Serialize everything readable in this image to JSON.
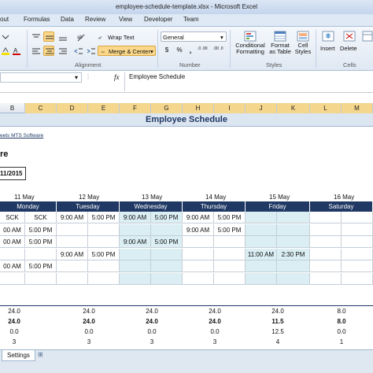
{
  "window": {
    "title": "employee-schedule-template.xlsx - Microsoft Excel"
  },
  "ribbon_tabs": [
    "out",
    "Formulas",
    "Data",
    "Review",
    "View",
    "Developer",
    "Team"
  ],
  "ribbon": {
    "wrap_text": "Wrap Text",
    "merge_center": "Merge & Center",
    "number_format": "General",
    "conditional_formatting": "Conditional Formatting",
    "format_as_table": "Format as Table",
    "cell_styles": "Cell Styles",
    "insert": "Insert",
    "delete": "Delete",
    "groups": {
      "alignment": "Alignment",
      "number": "Number",
      "styles": "Styles",
      "cells": "Cells"
    },
    "currency_symbol": "$",
    "percent_symbol": "%",
    "comma_symbol": ",",
    "inc_decimal": ".0 .00",
    "dec_decimal": ".00 .0"
  },
  "formula_bar": {
    "fx": "fx",
    "content": "Employee Schedule"
  },
  "columns": [
    "B",
    "C",
    "D",
    "E",
    "F",
    "G",
    "H",
    "I",
    "J",
    "K",
    "L",
    "M"
  ],
  "sheet": {
    "title": "Employee Schedule",
    "link_text": "eets MTS Software",
    "partial_label": "re",
    "date_box": "11/2015",
    "dates": [
      "11 May",
      "12 May",
      "13 May",
      "14 May",
      "15 May",
      "16 May"
    ],
    "days": [
      "Monday",
      "Tuesday",
      "Wednesday",
      "Thursday",
      "Friday",
      "Saturday"
    ],
    "rows": [
      [
        "SCK",
        "SCK",
        "9:00 AM",
        "5:00 PM",
        "9:00 AM",
        "5:00 PM",
        "9:00 AM",
        "5:00 PM",
        "",
        "",
        "",
        ""
      ],
      [
        "00 AM",
        "5:00 PM",
        "",
        "",
        "",
        "",
        "9:00 AM",
        "5:00 PM",
        "",
        "",
        "",
        ""
      ],
      [
        "00 AM",
        "5:00 PM",
        "",
        "",
        "9:00 AM",
        "5:00 PM",
        "",
        "",
        "",
        "",
        "",
        ""
      ],
      [
        "",
        "",
        "9:00 AM",
        "5:00 PM",
        "",
        "",
        "",
        "",
        "11:00 AM",
        "2:30 PM",
        "",
        ""
      ],
      [
        "00 AM",
        "5:00 PM",
        "",
        "",
        "",
        "",
        "",
        "",
        "",
        "",
        "",
        ""
      ],
      [
        "",
        "",
        "",
        "",
        "",
        "",
        "",
        "",
        "",
        "",
        "",
        ""
      ]
    ],
    "totals": [
      [
        "24.0",
        "24.0",
        "24.0",
        "24.0",
        "24.0",
        "8.0"
      ],
      [
        "24.0",
        "24.0",
        "24.0",
        "24.0",
        "11.5",
        "8.0"
      ],
      [
        "0.0",
        "0.0",
        "0.0",
        "0.0",
        "12.5",
        "0.0"
      ],
      [
        "3",
        "3",
        "3",
        "3",
        "4",
        "1"
      ]
    ]
  },
  "sheet_tabs": [
    "Settings"
  ],
  "colors": {
    "header_navy": "#1f3864",
    "shade_blue": "#daeef3",
    "title_fill": "#dce6f1"
  }
}
